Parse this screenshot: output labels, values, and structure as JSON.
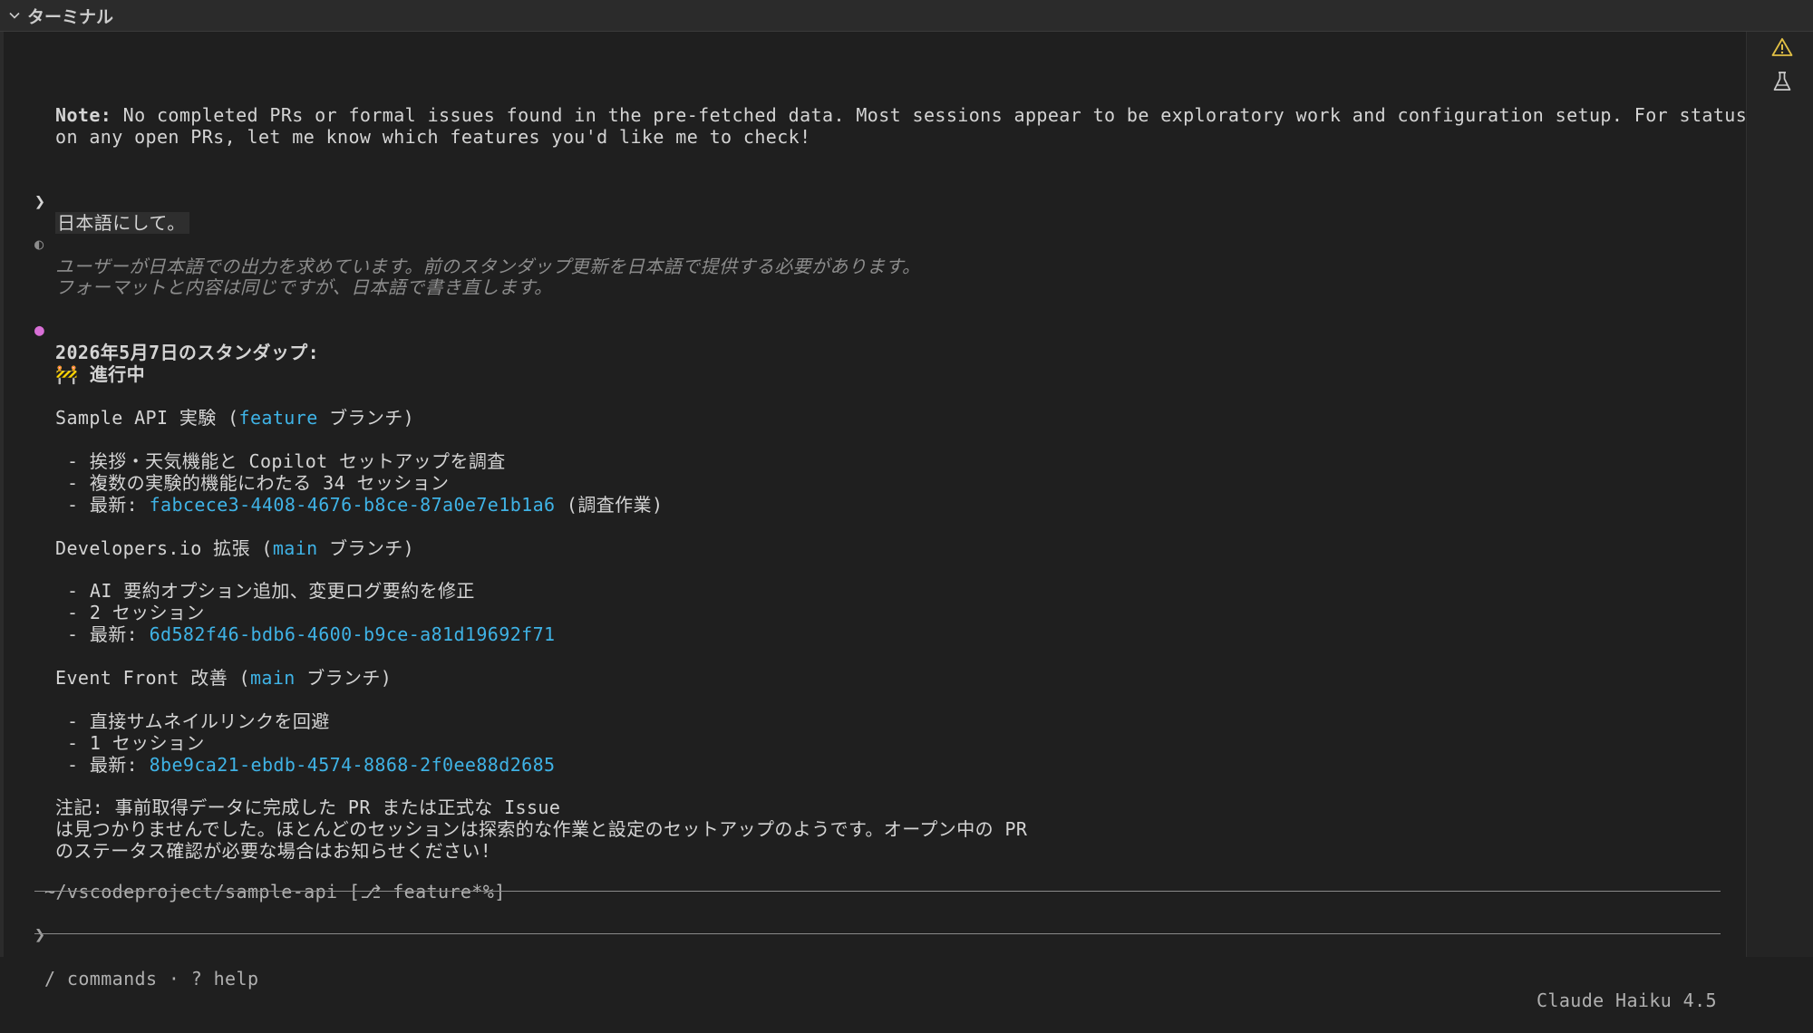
{
  "panel": {
    "title": "ターミナル"
  },
  "sidebar": {
    "icons": [
      "warning-icon",
      "flask-icon"
    ]
  },
  "note_en": {
    "label": "Note:",
    "text1": " No completed PRs or formal issues found in the pre-fetched data. Most sessions appear to be exploratory work and configuration setup. For status",
    "text2": "on any open PRs, let me know which features you'd like me to check!"
  },
  "user_prompt": {
    "marker": "❯",
    "text": "日本語にして。"
  },
  "thinking": {
    "marker": "◐",
    "line1": "ユーザーが日本語での出力を求めています。前のスタンダップ更新を日本語で提供する必要があります。",
    "line2": "フォーマットと内容は同じですが、日本語で書き直します。"
  },
  "response": {
    "marker": "●",
    "heading": "2026年5月7日のスタンダップ:",
    "section_icon": "🚧",
    "section_title": "進行中",
    "projects": [
      {
        "name": "Sample API 実験 (",
        "branch": "feature",
        "branch_suffix": " ブランチ)",
        "bullets": [
          "- 挨拶・天気機能と Copilot セットアップを調査",
          "- 複数の実験的機能にわたる 34 セッション"
        ],
        "latest_label": "- 最新: ",
        "latest_id": "fabcece3-4408-4676-b8ce-87a0e7e1b1a6",
        "latest_suffix": " (調査作業)"
      },
      {
        "name": "Developers.io 拡張 (",
        "branch": "main",
        "branch_suffix": " ブランチ)",
        "bullets": [
          "- AI 要約オプション追加、変更ログ要約を修正",
          "- 2 セッション"
        ],
        "latest_label": "- 最新: ",
        "latest_id": "6d582f46-bdb6-4600-b9ce-a81d19692f71",
        "latest_suffix": ""
      },
      {
        "name": "Event Front 改善 (",
        "branch": "main",
        "branch_suffix": " ブランチ)",
        "bullets": [
          "- 直接サムネイルリンクを回避",
          "- 1 セッション"
        ],
        "latest_label": "- 最新: ",
        "latest_id": "8be9ca21-ebdb-4574-8868-2f0ee88d2685",
        "latest_suffix": ""
      }
    ],
    "note_ja": {
      "line1": "注記: 事前取得データに完成した PR または正式な Issue",
      "line2": "は見つかりませんでした。ほとんどのセッションは探索的な作業と設定のセットアップのようです。オープン中の PR",
      "line3": "のステータス確認が必要な場合はお知らせください!"
    }
  },
  "cwd": "~/vscodeproject/sample-api [⎇ feature*%]",
  "input": {
    "marker": "❯",
    "value": ""
  },
  "status": {
    "hint": "/ commands · ? help",
    "model": "Claude Haiku 4.5"
  },
  "colors": {
    "link": "#3fb3e6",
    "response_marker": "#d86fd6",
    "warning": "#e2c045"
  }
}
